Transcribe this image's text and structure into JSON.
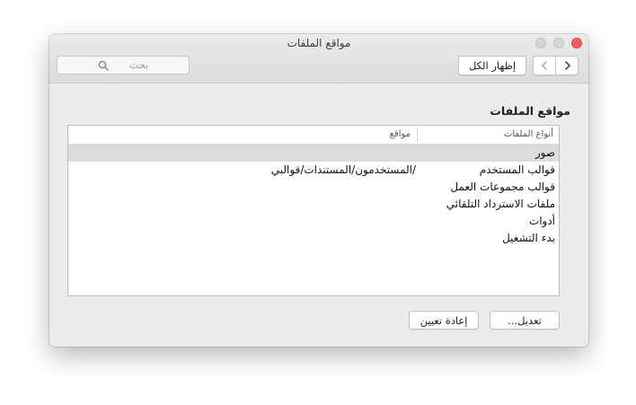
{
  "window": {
    "title": "مواقع الملفات"
  },
  "toolbar": {
    "search_placeholder": "بحث",
    "show_all_label": "إظهار الكل"
  },
  "section": {
    "title": "مواقع الملفات"
  },
  "table": {
    "headers": {
      "type": "أنواع الملفات",
      "location": "مواقع"
    },
    "rows": [
      {
        "type": "صور",
        "location": "",
        "selected": true
      },
      {
        "type": "قوالب المستخدم",
        "location": "/المستخدمون/المستندات/قوالبي",
        "selected": false
      },
      {
        "type": "قوالب مجموعات العمل",
        "location": "",
        "selected": false
      },
      {
        "type": "ملفات الاسترداد التلقائي",
        "location": "",
        "selected": false
      },
      {
        "type": "أدوات",
        "location": "",
        "selected": false
      },
      {
        "type": "بدء التشغيل",
        "location": "",
        "selected": false
      }
    ]
  },
  "buttons": {
    "edit_label": "تعديل...",
    "reset_label": "إعادة تعيين"
  },
  "colors": {
    "close": "#fc5f57",
    "selection": "#dcdcdc"
  }
}
